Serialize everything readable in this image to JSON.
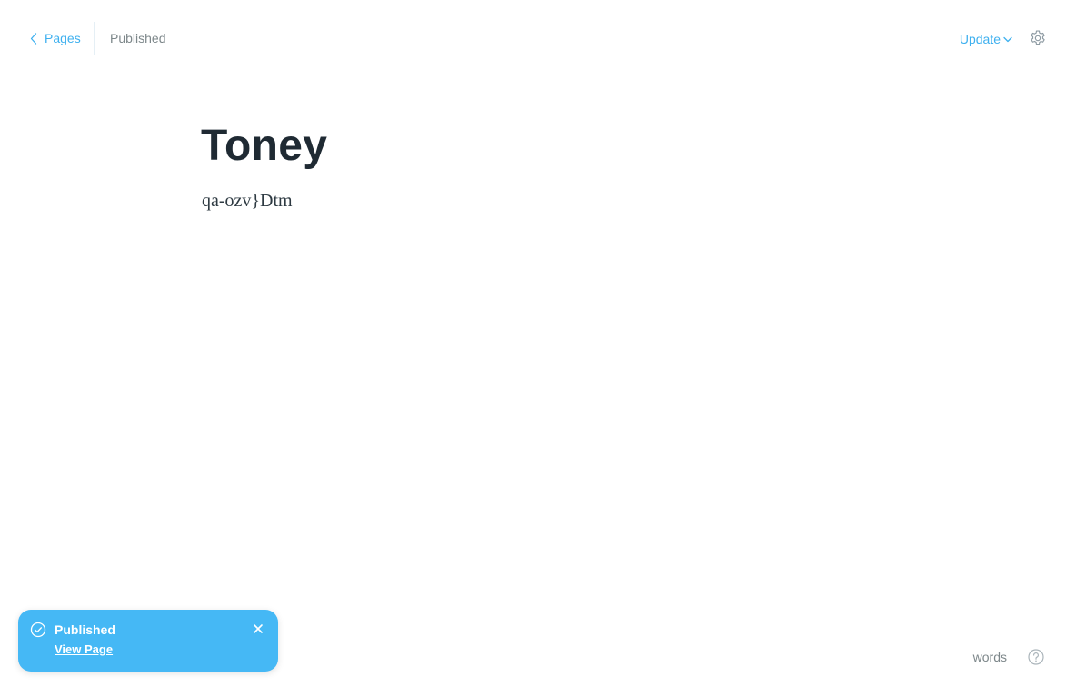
{
  "header": {
    "back_label": "Pages",
    "status": "Published",
    "update_label": "Update"
  },
  "post": {
    "title": "Toney",
    "body": "qa-ozv}Dtm"
  },
  "footer": {
    "word_count_label": "words"
  },
  "toast": {
    "title": "Published",
    "link_label": "View Page"
  },
  "colors": {
    "accent": "#3eb0ef",
    "toast_background": "#45b8f5",
    "muted_text": "#7d878a",
    "title_text": "#1f2a33"
  },
  "icons": {
    "back": "chevron-left-icon",
    "update": "chevron-down-icon",
    "settings": "gear-icon",
    "help": "question-circle-icon",
    "toast_status": "check-circle-icon",
    "toast_close": "close-icon"
  }
}
